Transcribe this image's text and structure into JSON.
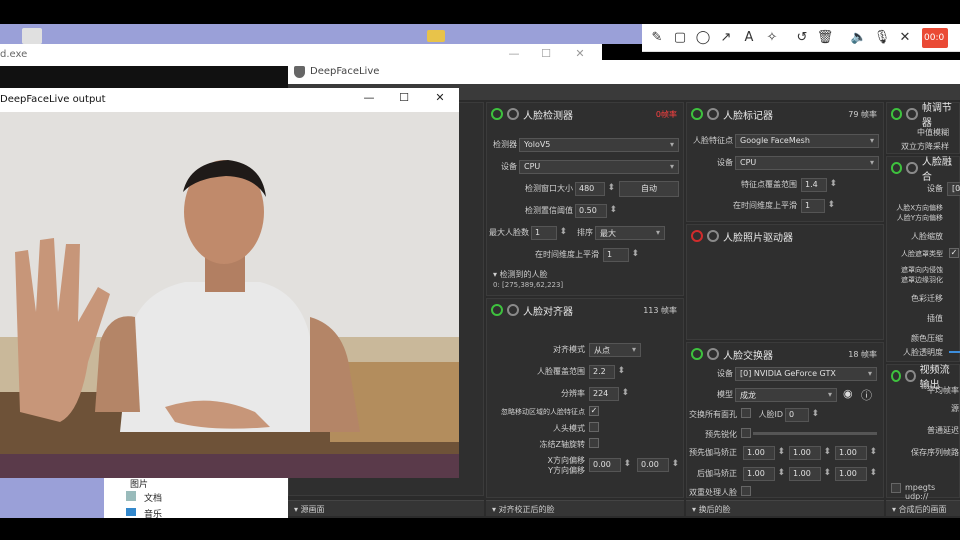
{
  "background": {
    "cmd_title": "d.exe"
  },
  "recorder": {
    "tools": [
      "pen-icon",
      "rectangle-icon",
      "circle-icon",
      "arrow-icon",
      "text-icon",
      "highlighter-icon",
      "undo-icon",
      "trash-icon",
      "speaker-icon",
      "microphone-icon",
      "close-icon"
    ],
    "timer": "00:0"
  },
  "explorer": {
    "item1": "图片",
    "item2": "文档",
    "item3": "音乐"
  },
  "output_window": {
    "title": "DeepFaceLive output"
  },
  "app": {
    "title": "DeepFaceLive"
  },
  "face_detector": {
    "title": "人脸检测器",
    "fps": "0帧率",
    "detector_label": "检测器",
    "detector_value": "YoloV5",
    "device_label": "设备",
    "device_value": "CPU",
    "window_size_label": "检测窗口大小",
    "window_size_value": "480",
    "auto_button": "自动",
    "threshold_label": "检测置信阈值",
    "threshold_value": "0.50",
    "max_faces_label": "最大人脸数",
    "max_faces_value": "1",
    "sort_label": "排序",
    "sort_value": "最大",
    "temporal_label": "在时间维度上平滑",
    "temporal_value": "1",
    "detected_label": "检测到的人脸",
    "detected_value": "0: [275,389,62,223]"
  },
  "face_marker": {
    "title": "人脸标记器",
    "fps": "79 帧率",
    "marker_label": "人脸特征点",
    "marker_value": "Google FaceMesh",
    "device_label": "设备",
    "device_value": "CPU",
    "coverage_label": "特征点覆盖范围",
    "coverage_value": "1.4",
    "temporal_label": "在时间维度上平滑",
    "temporal_value": "1"
  },
  "face_animator": {
    "title": "人脸照片驱动器"
  },
  "face_aligner": {
    "title": "人脸对齐器",
    "fps": "113 帧率",
    "align_mode_label": "对齐模式",
    "align_mode_value": "从点",
    "coverage_label": "人脸覆盖范围",
    "coverage_value": "2.2",
    "resolution_label": "分辨率",
    "resolution_value": "224",
    "exclude_moving_label": "忽略移动区域的人脸特征点",
    "head_mode_label": "人头模式",
    "freeze_z_label": "冻结Z轴旋转",
    "x_offset_label": "X方向偏移",
    "y_offset_label": "Y方向偏移",
    "x_offset_value": "0.00",
    "y_offset_value": "0.00"
  },
  "face_swapper": {
    "title": "人脸交换器",
    "fps": "18 帧率",
    "device_label": "设备",
    "device_value": "[0] NVIDIA GeForce GTX",
    "model_label": "模型",
    "model_value": "成龙",
    "swap_all_label": "交换所有面孔",
    "face_id_label": "人脸ID",
    "face_id_value": "0",
    "presharpen_label": "预先锐化",
    "pre_gamma_label": "预先伽马矫正",
    "post_gamma_label": "后伽马矫正",
    "gamma_values": [
      "1.00",
      "1.00",
      "1.00"
    ],
    "two_pass_label": "双重处理人脸"
  },
  "frame_adjuster": {
    "title": "帧调节器",
    "median_label": "中值模糊",
    "degrade_label": "双立方降采样"
  },
  "face_merger": {
    "title": "人脸融合",
    "device_label": "设备",
    "device_value": "[0",
    "x_offset_label": "人脸X方向偏移",
    "y_offset_label": "人脸Y方向偏移",
    "scale_label": "人脸缩放",
    "mask_type_label": "人脸遮罩类型",
    "erode_label": "遮罩向内侵蚀",
    "blur_label": "遮罩边缘羽化",
    "color_transfer_label": "色彩迁移",
    "interpolation_label": "插值",
    "color_compression_label": "颜色压缩",
    "opacity_label": "人脸透明度"
  },
  "stream_output": {
    "title": "视频流输出",
    "avg_fps_label": "平均帧率",
    "source_label": "源",
    "target_delay_label": "普通延迟",
    "save_seq_label": "保存序列帧路",
    "mpegts_label": "mpegts udp://"
  },
  "bottom_bars": {
    "source_frame": "源画面",
    "aligned_face": "对齐校正后的脸",
    "swapped_face": "换后的脸",
    "merged_frame": "合成后的画面"
  }
}
